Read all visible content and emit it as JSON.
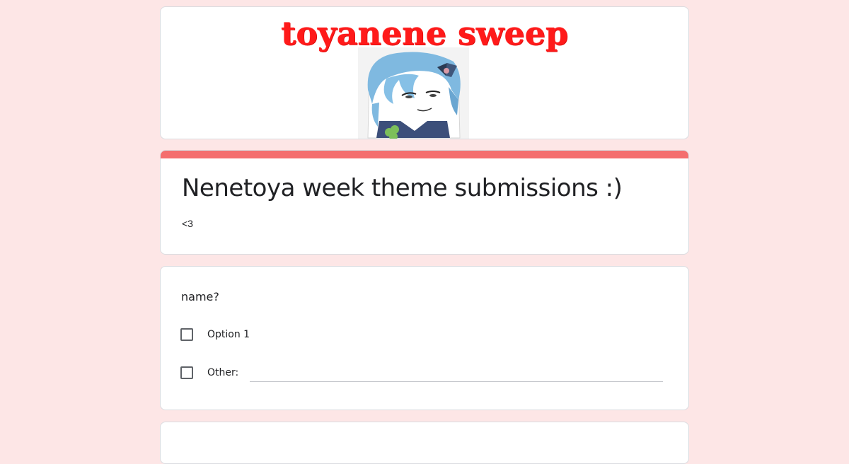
{
  "banner": {
    "title": "toyanene sweep",
    "image": "plush-photo"
  },
  "form": {
    "title": "Nenetoya week theme submissions :)",
    "description": "<3",
    "accent_color": "#f46e6e",
    "background_color": "#fde6e6"
  },
  "question": {
    "text": "name?",
    "options": [
      {
        "label": "Option 1",
        "checked": false
      },
      {
        "label": "Other:",
        "checked": false
      }
    ]
  }
}
